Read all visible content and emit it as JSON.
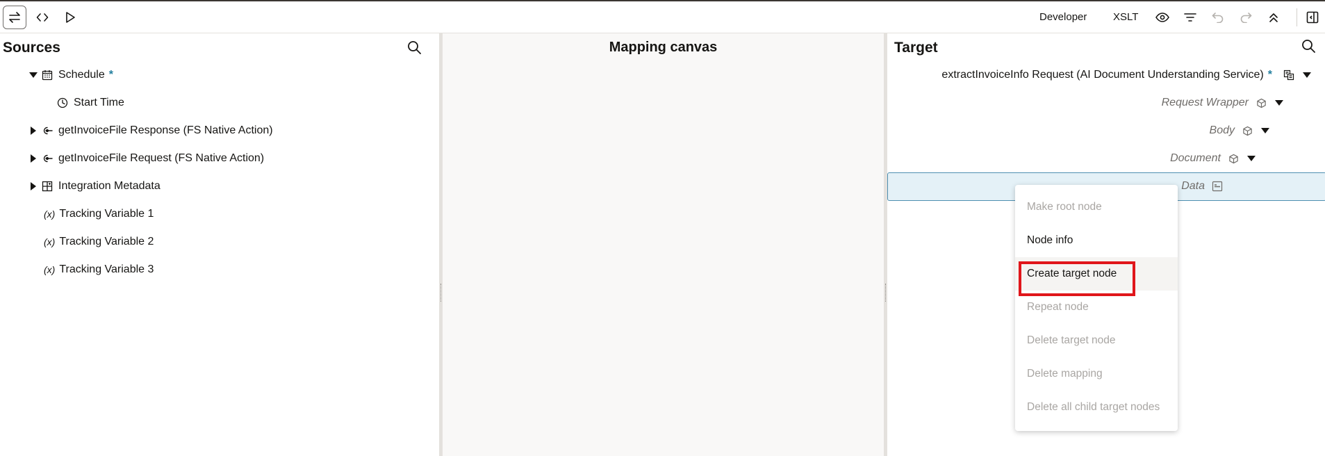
{
  "toolbar": {
    "left_buttons": [
      "swap-icon",
      "code-icon",
      "play-icon"
    ],
    "developer_label": "Developer",
    "xslt_label": "XSLT",
    "right_icons": [
      "eye-icon",
      "filter-icon",
      "undo-icon",
      "redo-icon",
      "collapse-up-icon",
      "panel-toggle-icon"
    ]
  },
  "sources": {
    "title": "Sources",
    "items": [
      {
        "label": "Schedule",
        "star": "*"
      },
      {
        "label": "Start Time"
      },
      {
        "label": "getInvoiceFile Response (FS Native Action)"
      },
      {
        "label": "getInvoiceFile Request (FS Native Action)"
      },
      {
        "label": "Integration Metadata"
      },
      {
        "prefix": "(x)",
        "label": "Tracking Variable 1"
      },
      {
        "prefix": "(x)",
        "label": "Tracking Variable 2"
      },
      {
        "prefix": "(x)",
        "label": "Tracking Variable 3"
      }
    ]
  },
  "canvas": {
    "title": "Mapping canvas"
  },
  "target": {
    "title": "Target",
    "root": {
      "label": "extractInvoiceInfo Request (AI Document Understanding Service)",
      "star": "*"
    },
    "nodes": [
      {
        "label": "Request Wrapper"
      },
      {
        "label": "Body"
      },
      {
        "label": "Document"
      },
      {
        "label": "Data"
      }
    ]
  },
  "context_menu": {
    "items": [
      {
        "label": "Make root node",
        "enabled": false
      },
      {
        "label": "Node info",
        "enabled": true
      },
      {
        "label": "Create target node",
        "enabled": true,
        "highlighted": true
      },
      {
        "label": "Repeat node",
        "enabled": false
      },
      {
        "label": "Delete target node",
        "enabled": false
      },
      {
        "label": "Delete mapping",
        "enabled": false
      },
      {
        "label": "Delete all child target nodes",
        "enabled": false
      }
    ]
  },
  "colors": {
    "accent_star": "#227e9e",
    "highlight_border": "#e0161b",
    "selected_row_bg": "#e4f1f7"
  }
}
